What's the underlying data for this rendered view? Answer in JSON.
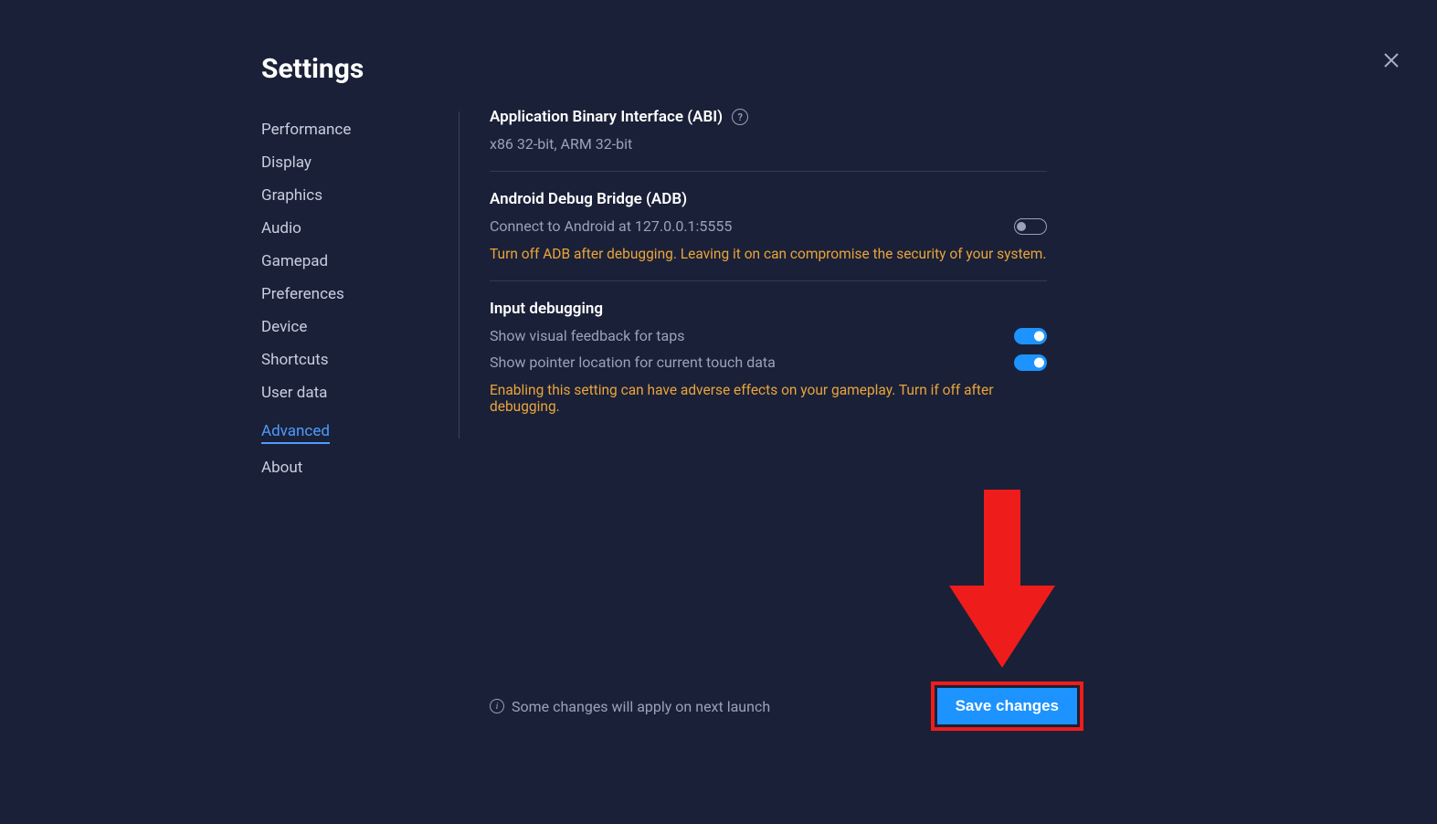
{
  "header": {
    "title": "Settings"
  },
  "sidebar": {
    "items": [
      {
        "label": "Performance",
        "active": false
      },
      {
        "label": "Display",
        "active": false
      },
      {
        "label": "Graphics",
        "active": false
      },
      {
        "label": "Audio",
        "active": false
      },
      {
        "label": "Gamepad",
        "active": false
      },
      {
        "label": "Preferences",
        "active": false
      },
      {
        "label": "Device",
        "active": false
      },
      {
        "label": "Shortcuts",
        "active": false
      },
      {
        "label": "User data",
        "active": false
      },
      {
        "label": "Advanced",
        "active": true
      },
      {
        "label": "About",
        "active": false
      }
    ]
  },
  "content": {
    "abi": {
      "title": "Application Binary Interface (ABI)",
      "value": "x86 32-bit, ARM 32-bit"
    },
    "adb": {
      "title": "Android Debug Bridge (ADB)",
      "connect_label": "Connect to Android at 127.0.0.1:5555",
      "connect_on": false,
      "warning": "Turn off ADB after debugging. Leaving it on can compromise the security of your system."
    },
    "input_debugging": {
      "title": "Input debugging",
      "rows": [
        {
          "label": "Show visual feedback for taps",
          "on": true
        },
        {
          "label": "Show pointer location for current touch data",
          "on": true
        }
      ],
      "warning": "Enabling this setting can have adverse effects on your gameplay. Turn if off after debugging."
    }
  },
  "footer": {
    "note": "Some changes will apply on next launch",
    "save_label": "Save changes"
  }
}
